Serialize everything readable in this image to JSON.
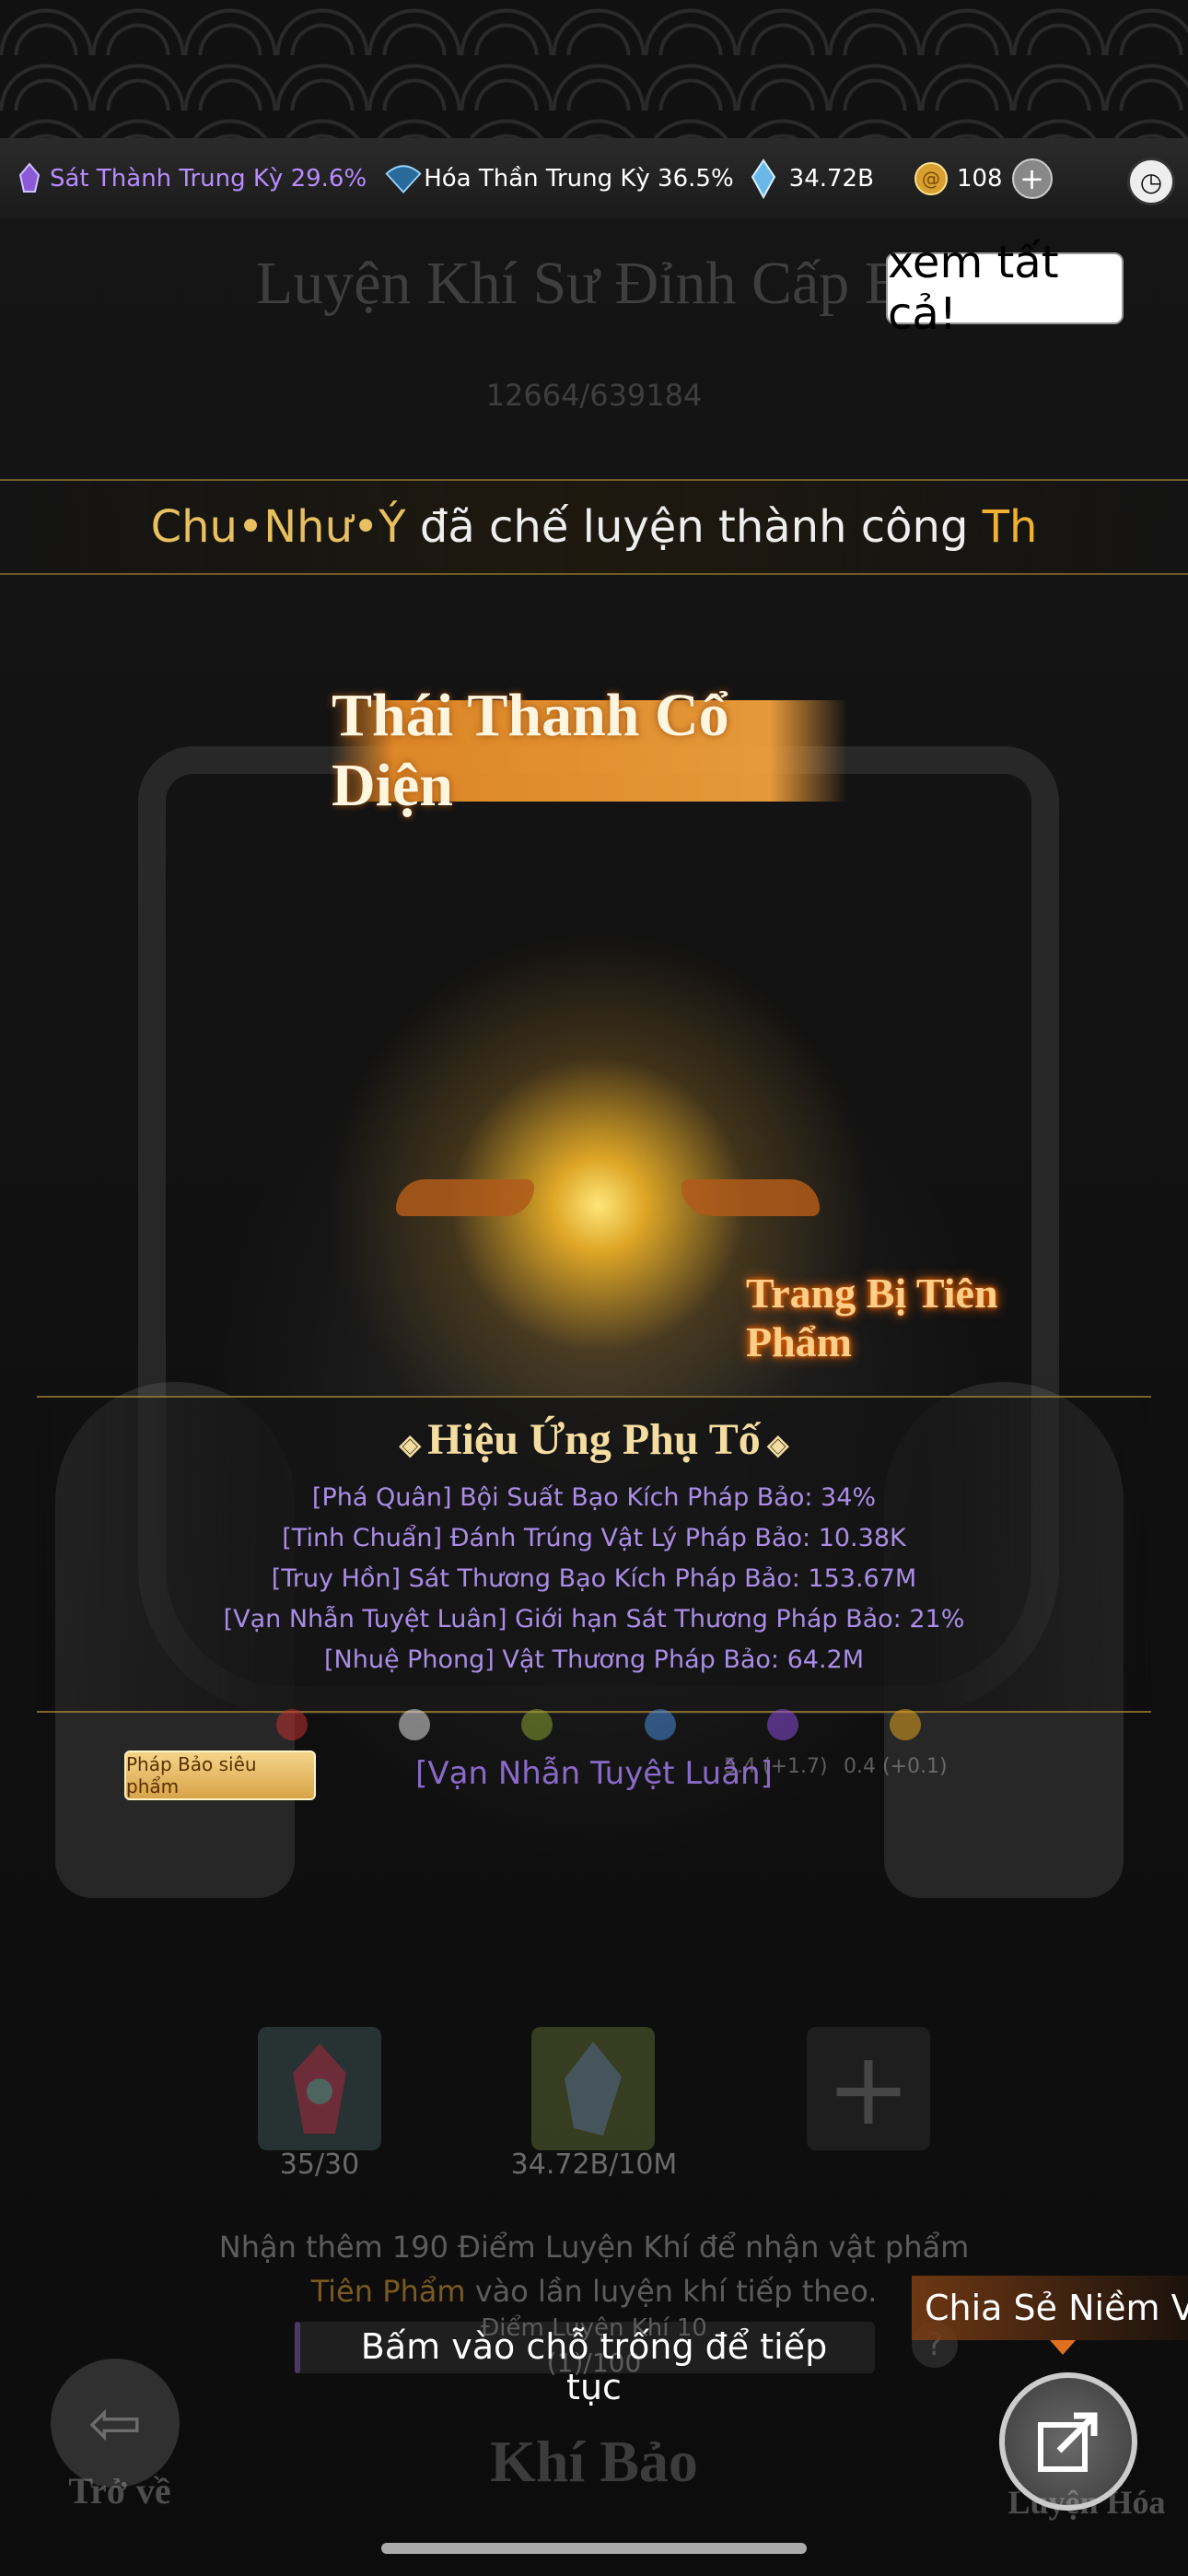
{
  "topbar": {
    "realm1": {
      "icon": "purple-realm-icon",
      "text": "Sát Thành Trung Kỳ 29.6%",
      "color": "#b98cff"
    },
    "realm2": {
      "icon": "fan-realm-icon",
      "text": "Hóa Thần Trung Kỳ 36.5%",
      "color": "#ffffff"
    },
    "crystal": {
      "icon": "crystal-icon",
      "value": "34.72B"
    },
    "coin": {
      "icon": "gold-coin-icon",
      "value": "108"
    },
    "add_icon": "plus-icon",
    "clock_icon": "clock-icon"
  },
  "header": {
    "title": "Luyện Khí Sư Đỉnh Cấp Bậ",
    "progress_text": "12664/639184",
    "view_all": "xem tất cả!"
  },
  "ticker": {
    "player": "Chu•Như•Ý",
    "message": " đã chế luyện thành công ",
    "item": "Th"
  },
  "result": {
    "item_name": "Thái Thanh Cổ Diện",
    "rarity": "Trang Bị Tiên Phẩm",
    "glow_color": "#ffd75a"
  },
  "affix": {
    "title": "Hiệu Ứng Phụ Tố",
    "lines": [
      "[Phá Quân] Bội Suất Bạo Kích Pháp Bảo: 34%",
      "[Tinh Chuẩn] Đánh Trúng Vật Lý Pháp Bảo: 10.38K",
      "[Truy Hồn] Sát Thương Bạo Kích Pháp Bảo: 153.67M",
      "[Vạn Nhẫn Tuyệt Luân] Giới hạn Sát Thương Pháp Bảo: 21%",
      "[Nhuệ Phong] Vật Thương Pháp Bảo: 64.2M"
    ]
  },
  "background_stats": {
    "stat1": "5.4 (+1.7)",
    "stat2": "0.4 (+0.1)"
  },
  "weapon": {
    "badge": "Pháp Bảo siêu phẩm",
    "name": "[Vạn Nhẫn Tuyệt Luân]"
  },
  "materials": [
    {
      "icon": "red-gem-icon",
      "count": "35/30"
    },
    {
      "icon": "blue-crystal-icon",
      "count": "34.72B/10M"
    },
    {
      "icon": "add-slot-icon",
      "count": ""
    }
  ],
  "info": {
    "line1": "Nhận thêm 190 Điểm Luyện Khí để nhận vật phẩm",
    "line2_highlight": "Tiên Phẩm",
    "line2_rest": " vào lần luyện khí tiếp theo.",
    "progress_label": "Điểm Luyện Khí 10",
    "progress_value": "(1)/100",
    "progress_fraction": 0.01
  },
  "prompt": {
    "continue": "Bấm vào chỗ trống để tiếp tục",
    "share": "Chia Sẻ Niềm Vui"
  },
  "nav": {
    "back_label": "Trở về",
    "bottom_title": "Khí Bảo",
    "right_label": "Luyện Hóa"
  }
}
